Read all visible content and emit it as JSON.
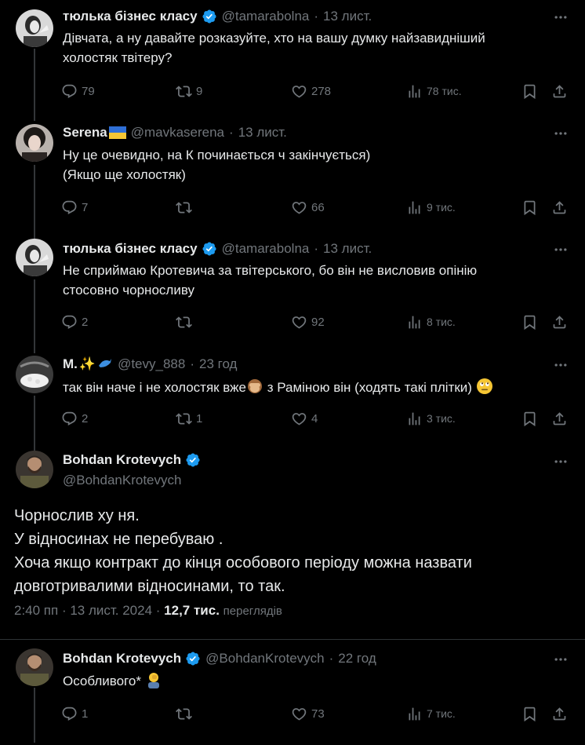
{
  "tweets": [
    {
      "name": "тюлька бізнес класу",
      "handle": "@tamarabolna",
      "time": "13 лист.",
      "text": [
        "Дівчата, а ну давайте розказуйте, хто на вашу думку найзавидніший",
        "холостяк твітеру?"
      ],
      "replies": "79",
      "retweets": "9",
      "likes": "278",
      "views": "78 тис."
    },
    {
      "name": "Serena",
      "handle": "@mavkaserena",
      "time": "13 лист.",
      "text": [
        "Ну це очевидно, на К починається ч закінчується)",
        "(Якщо ще холостяк)"
      ],
      "replies": "7",
      "retweets": "",
      "likes": "66",
      "views": "9 тис."
    },
    {
      "name": "тюлька бізнес класу",
      "handle": "@tamarabolna",
      "time": "13 лист.",
      "text": [
        "Не сприймаю Кротевича за твітерського, бо він не висловив опінію",
        "стосовно чорносливу"
      ],
      "replies": "2",
      "retweets": "",
      "likes": "92",
      "views": "8 тис."
    },
    {
      "name": "M.",
      "handle": "@tevy_888",
      "time": "23 год",
      "text_a": "так він наче і не холостяк вже",
      "text_b": " з Раміною він (ходять такі плітки) ",
      "replies": "2",
      "retweets": "1",
      "likes": "4",
      "views": "3 тис."
    }
  ],
  "main": {
    "name": "Bohdan Krotevych",
    "handle": "@BohdanKrotevych",
    "lines": [
      "Чорнослив ху   ня.",
      "У відносинах не перебуваю .",
      "Хоча якщо контракт до кінця особового періоду можна назвати",
      "довготривалими відносинами, то так."
    ],
    "time": "2:40 пп · 13 лист. 2024 · ",
    "views_count": "12,7 тис.",
    "views_label": "переглядів"
  },
  "reply": {
    "name": "Bohdan Krotevych",
    "handle": "@BohdanKrotevych",
    "time": "22 год",
    "text": "Особливого* ",
    "replies": "1",
    "retweets": "",
    "likes": "73",
    "views": "7 тис."
  },
  "colors": {
    "background": "#000000",
    "text": "#e7e9ea",
    "muted": "#71767b",
    "verified": "#1d9bf0"
  },
  "icons": [
    "reply-icon",
    "retweet-icon",
    "like-icon",
    "views-icon",
    "bookmark-icon",
    "share-icon",
    "more-icon",
    "verified-icon"
  ]
}
